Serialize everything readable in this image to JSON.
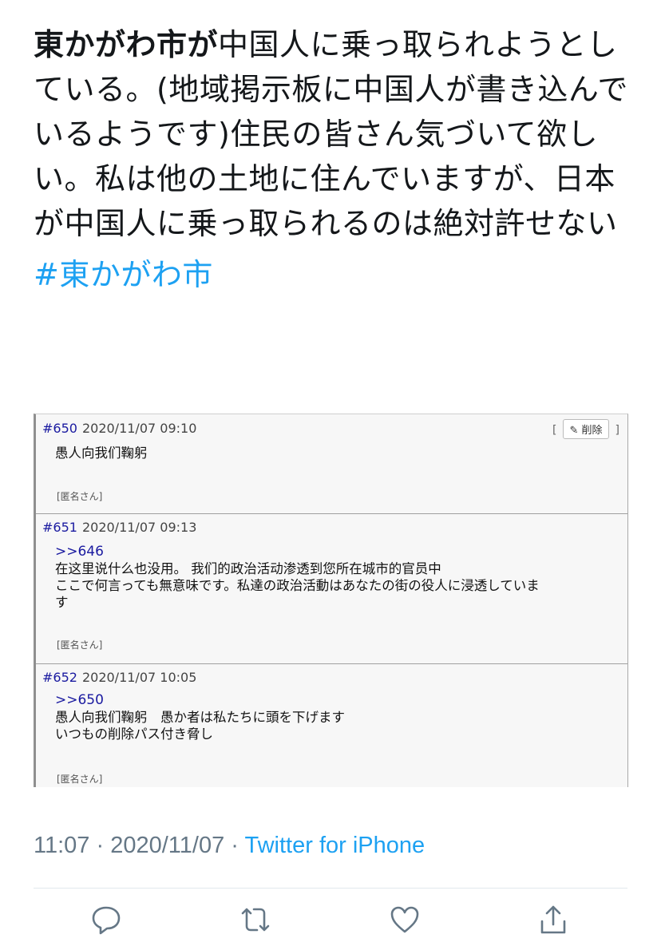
{
  "tweet": {
    "bold_part": "東かがわ市が",
    "text": "中国人に乗っ取られようとしている。(地域掲示板に中国人が書き込んでいるようです)住民の皆さん気づいて欲しい。私は他の土地に住んでいますが、日本が中国人に乗っ取られるのは絶対許せない",
    "hashtag": "#東かがわ市"
  },
  "screenshot": {
    "posts": [
      {
        "number": "#650",
        "date": "2020/11/07 09:10",
        "delete_label": "削除",
        "reply": "",
        "lines": [
          "愚人向我们鞠躬"
        ],
        "author": "[匿名さん]"
      },
      {
        "number": "#651",
        "date": "2020/11/07 09:13",
        "reply": ">>646",
        "lines": [
          "在这里说什么也没用。 我们的政治活动渗透到您所在城市的官员中",
          "ここで何言っても無意味です。私達の政治活動はあなたの街の役人に浸透していま",
          "す"
        ],
        "author": "[匿名さん]"
      },
      {
        "number": "#652",
        "date": "2020/11/07 10:05",
        "reply": ">>650",
        "lines": [
          "愚人向我们鞠躬　愚か者は私たちに頭を下げます",
          "いつもの削除パス付き脅し"
        ],
        "author": "[匿名さん]"
      }
    ]
  },
  "meta": {
    "time": "11:07",
    "date": "2020/11/07",
    "separator": "·",
    "source": "Twitter for iPhone"
  },
  "actions": {
    "reply_icon": "reply-icon",
    "retweet_icon": "retweet-icon",
    "like_icon": "heart-icon",
    "share_icon": "share-icon"
  }
}
